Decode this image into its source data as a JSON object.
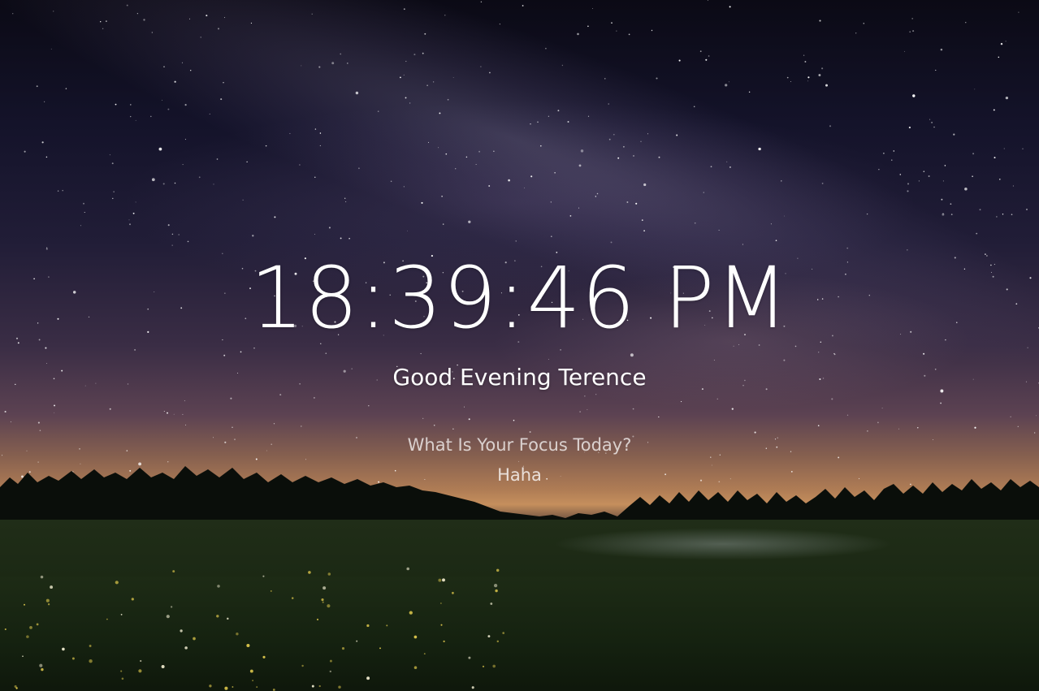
{
  "clock": {
    "time": "18:39:46 PM"
  },
  "greeting": {
    "text": "Good Evening Terence"
  },
  "focus": {
    "question": "What Is Your Focus Today?",
    "value": "Haha"
  },
  "background": {
    "sky_top": "#0b0a15",
    "horizon_glow": "#c58f5d",
    "field": "#1d2b15"
  }
}
